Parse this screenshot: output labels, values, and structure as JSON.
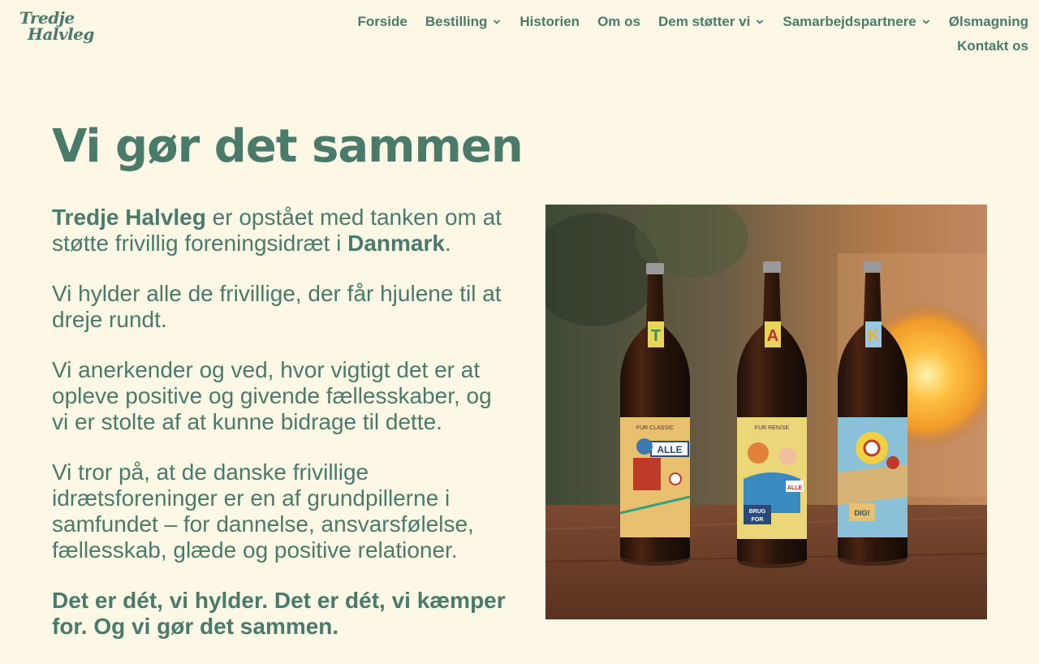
{
  "header": {
    "logo_line1": "Tredje",
    "logo_line2": "Halvleg",
    "nav": [
      {
        "label": "Forside",
        "has_dropdown": false
      },
      {
        "label": "Bestilling",
        "has_dropdown": true
      },
      {
        "label": "Historien",
        "has_dropdown": false
      },
      {
        "label": "Om os",
        "has_dropdown": false
      },
      {
        "label": "Dem støtter vi",
        "has_dropdown": true
      },
      {
        "label": "Samarbejdspartnere",
        "has_dropdown": true
      },
      {
        "label": "Ølsmagning",
        "has_dropdown": false
      },
      {
        "label": "Kontakt os",
        "has_dropdown": false
      }
    ]
  },
  "main": {
    "title": "Vi gør det sammen",
    "p1": {
      "brand": "Tredje Halvleg",
      "text": " er opstået med tanken om at støtte frivillig foreningsidræt i ",
      "country": "Danmark",
      "end": "."
    },
    "p2": "Vi hylder alle de frivillige, der får hjulene til at dreje rundt.",
    "p3": "Vi anerkender og ved, hvor vigtigt det er at opleve positive og givende fællesskaber, og vi er stolte af at kunne bidrage til dette.",
    "p4": "Vi tror på, at de danske frivillige idrætsforeninger er en af grundpillerne i samfundet – for dannelse, ansvarsfølelse, fællesskab, glæde og positive relationer.",
    "p5": "Det er dét, vi hylder. Det er dét, vi kæmper for. Og vi gør det sammen."
  },
  "photo": {
    "bottle_letters": [
      "T",
      "A",
      "K"
    ],
    "label_texts": [
      "FUR CLASSIC",
      "FUR REN/SE",
      "ALLE",
      "BRUG FOR",
      "DIG!"
    ]
  },
  "colors": {
    "background": "#fdf8e6",
    "text": "#4a7a6a"
  }
}
